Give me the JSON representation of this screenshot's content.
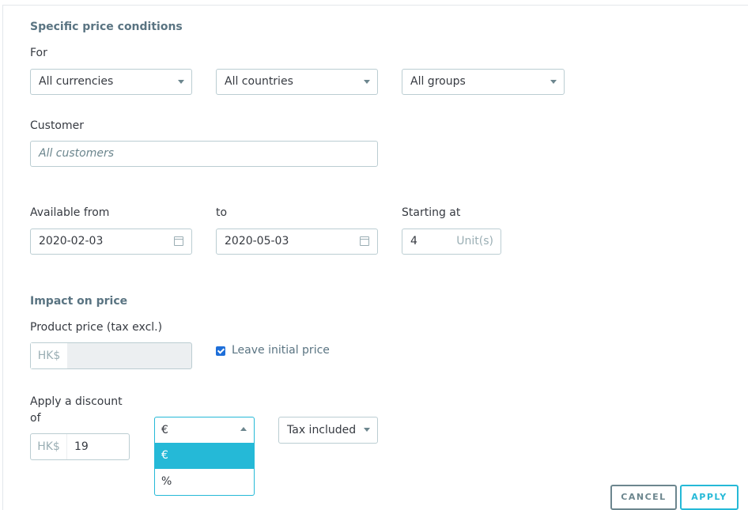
{
  "section1": {
    "title": "Specific price conditions",
    "for_label": "For",
    "currency_select": "All currencies",
    "country_select": "All countries",
    "group_select": "All groups",
    "customer_label": "Customer",
    "customer_placeholder": "All customers",
    "available_from_label": "Available from",
    "to_label": "to",
    "starting_at_label": "Starting at",
    "from_date": "2020-02-03",
    "to_date": "2020-05-03",
    "quantity": "4",
    "unit_suffix": "Unit(s)"
  },
  "section2": {
    "title": "Impact on price",
    "product_price_label": "Product price (tax excl.)",
    "currency_prefix": "HK$",
    "leave_initial_label": "Leave initial price",
    "leave_initial_checked": true,
    "discount_label_line1": "Apply a discount",
    "discount_label_line2": "of",
    "discount_prefix": "HK$",
    "discount_value": "19",
    "reduction_type_selected": "€",
    "reduction_type_options": [
      "€",
      "%"
    ],
    "tax_select": "Tax included"
  },
  "buttons": {
    "cancel": "CANCEL",
    "apply": "APPLY"
  },
  "colors": {
    "accent": "#25b9d7",
    "heading": "#5a7482",
    "border": "#bbcdd2",
    "cancel_border": "#6c868e"
  }
}
